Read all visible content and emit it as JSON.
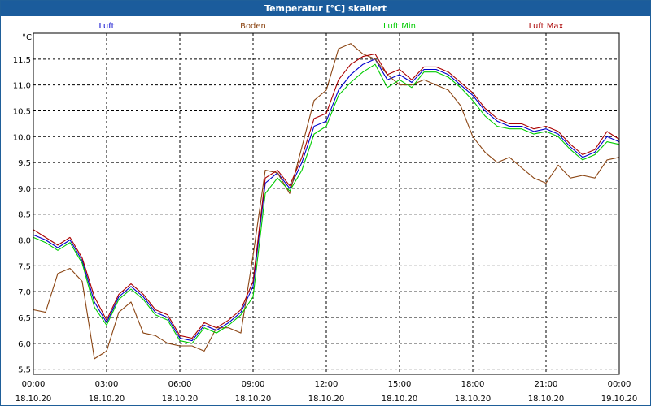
{
  "window": {
    "title": "Temperatur [°C] skaliert"
  },
  "chart_data": {
    "type": "line",
    "title": "Temperatur [°C] skaliert",
    "ylabel": "°C",
    "ylim": [
      5.4,
      12.0
    ],
    "xlim_hours": [
      0,
      24
    ],
    "grid": true,
    "legend_placement": "top",
    "x_ticks": [
      {
        "hour": 0,
        "time": "00:00",
        "date": "18.10.20"
      },
      {
        "hour": 3,
        "time": "03:00",
        "date": "18.10.20"
      },
      {
        "hour": 6,
        "time": "06:00",
        "date": "18.10.20"
      },
      {
        "hour": 9,
        "time": "09:00",
        "date": "18.10.20"
      },
      {
        "hour": 12,
        "time": "12:00",
        "date": "18.10.20"
      },
      {
        "hour": 15,
        "time": "15:00",
        "date": "18.10.20"
      },
      {
        "hour": 18,
        "time": "18:00",
        "date": "18.10.20"
      },
      {
        "hour": 21,
        "time": "21:00",
        "date": "18.10.20"
      },
      {
        "hour": 24,
        "time": "00:00",
        "date": "19.10.20"
      }
    ],
    "y_ticks": [
      "5,5",
      "6,0",
      "6,5",
      "7,0",
      "7,5",
      "8,0",
      "8,5",
      "9,0",
      "9,5",
      "10,0",
      "10,5",
      "11,0",
      "11,5"
    ],
    "y_tick_values": [
      5.5,
      6.0,
      6.5,
      7.0,
      7.5,
      8.0,
      8.5,
      9.0,
      9.5,
      10.0,
      10.5,
      11.0,
      11.5
    ],
    "x_hours": [
      0,
      0.5,
      1,
      1.5,
      2,
      2.5,
      3,
      3.5,
      4,
      4.5,
      5,
      5.5,
      6,
      6.5,
      7,
      7.5,
      8,
      8.5,
      9,
      9.5,
      10,
      10.5,
      11,
      11.5,
      12,
      12.5,
      13,
      13.5,
      14,
      14.5,
      15,
      15.5,
      16,
      16.5,
      17,
      17.5,
      18,
      18.5,
      19,
      19.5,
      20,
      20.5,
      21,
      21.5,
      22,
      22.5,
      23,
      23.5,
      24
    ],
    "series": [
      {
        "name": "Luft",
        "color": "#0000cc",
        "values": [
          8.1,
          8.0,
          7.85,
          8.0,
          7.6,
          6.8,
          6.4,
          6.9,
          7.1,
          6.9,
          6.6,
          6.5,
          6.1,
          6.05,
          6.35,
          6.25,
          6.4,
          6.6,
          7.1,
          9.1,
          9.3,
          9.0,
          9.5,
          10.2,
          10.3,
          10.9,
          11.2,
          11.4,
          11.5,
          11.1,
          11.2,
          11.05,
          11.3,
          11.3,
          11.2,
          11.0,
          10.8,
          10.5,
          10.3,
          10.2,
          10.2,
          10.1,
          10.15,
          10.05,
          9.8,
          9.6,
          9.7,
          10.0,
          9.9
        ]
      },
      {
        "name": "Boden",
        "color": "#8b4513",
        "values": [
          6.65,
          6.6,
          7.35,
          7.45,
          7.2,
          5.7,
          5.85,
          6.6,
          6.8,
          6.2,
          6.15,
          6.0,
          5.95,
          5.95,
          5.85,
          6.3,
          6.3,
          6.2,
          7.7,
          9.35,
          9.3,
          8.9,
          9.8,
          10.7,
          10.9,
          11.7,
          11.8,
          11.6,
          11.5,
          11.2,
          11.0,
          11.0,
          11.1,
          11.0,
          10.9,
          10.6,
          10.0,
          9.7,
          9.5,
          9.6,
          9.4,
          9.2,
          9.1,
          9.45,
          9.2,
          9.25,
          9.2,
          9.55,
          9.6
        ]
      },
      {
        "name": "Luft Min",
        "color": "#00cc00",
        "values": [
          8.05,
          7.95,
          7.8,
          7.95,
          7.55,
          6.7,
          6.35,
          6.85,
          7.05,
          6.85,
          6.55,
          6.45,
          6.05,
          6.0,
          6.3,
          6.2,
          6.35,
          6.55,
          6.9,
          8.9,
          9.2,
          8.95,
          9.35,
          10.05,
          10.2,
          10.8,
          11.05,
          11.25,
          11.4,
          10.95,
          11.1,
          10.95,
          11.25,
          11.25,
          11.15,
          10.95,
          10.7,
          10.4,
          10.2,
          10.15,
          10.15,
          10.05,
          10.1,
          10.0,
          9.75,
          9.55,
          9.65,
          9.9,
          9.85
        ]
      },
      {
        "name": "Luft Max",
        "color": "#aa0000",
        "values": [
          8.2,
          8.05,
          7.9,
          8.05,
          7.65,
          6.9,
          6.45,
          6.95,
          7.15,
          6.95,
          6.65,
          6.55,
          6.15,
          6.1,
          6.4,
          6.3,
          6.45,
          6.65,
          7.2,
          9.2,
          9.35,
          9.05,
          9.6,
          10.35,
          10.45,
          11.1,
          11.4,
          11.55,
          11.6,
          11.2,
          11.3,
          11.1,
          11.35,
          11.35,
          11.25,
          11.05,
          10.85,
          10.55,
          10.35,
          10.25,
          10.25,
          10.15,
          10.2,
          10.1,
          9.85,
          9.65,
          9.75,
          10.1,
          9.95
        ]
      }
    ]
  }
}
